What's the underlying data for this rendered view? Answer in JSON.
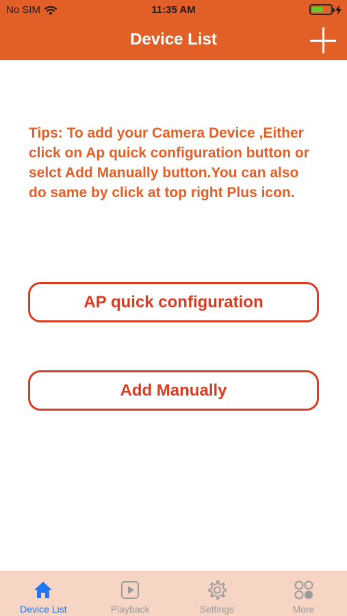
{
  "status_bar": {
    "carrier": "No SIM",
    "time": "11:35 AM"
  },
  "header": {
    "title": "Device List",
    "add_icon": "plus-icon"
  },
  "tips": "Tips:  To add your Camera Device ,Either click on Ap quick configuration button or selct Add Manually button.You can also do same by click at top right Plus icon.",
  "buttons": {
    "ap_quick": "AP quick configuration",
    "add_manually": "Add Manually"
  },
  "tabs": [
    {
      "label": "Device List",
      "icon": "home-icon",
      "active": true
    },
    {
      "label": "Playback",
      "icon": "play-icon",
      "active": false
    },
    {
      "label": "Settings",
      "icon": "gear-icon",
      "active": false
    },
    {
      "label": "More",
      "icon": "more-icon",
      "active": false
    }
  ],
  "colors": {
    "brand": "#e35f28",
    "button_border": "#d93c20",
    "tab_bar": "#f7d5c4",
    "active_tab": "#1e76f3"
  }
}
